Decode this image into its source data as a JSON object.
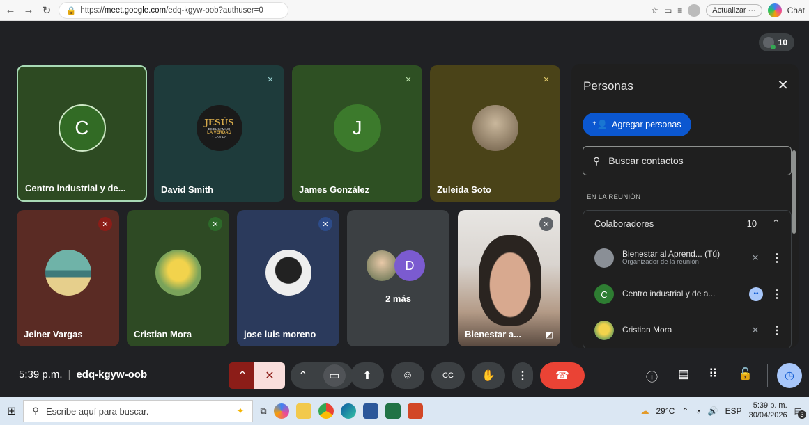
{
  "browser": {
    "url_prefix": "https://",
    "url_host": "meet.google.com",
    "url_path": "/edq-kgyw-oob?authuser=0",
    "update_label": "Actualizar",
    "chat_label": "Chat"
  },
  "meeting": {
    "participant_count": "10",
    "time": "5:39 p.m.",
    "code": "edq-kgyw-oob"
  },
  "tiles": [
    {
      "name": "Centro industrial y de...",
      "letter": "C"
    },
    {
      "name": "David Smith",
      "logo_title": "JESÚS",
      "logo_lines": [
        "ES EL CAMINO",
        "LA VERDAD",
        "Y LA VIDA"
      ]
    },
    {
      "name": "James González",
      "letter": "J"
    },
    {
      "name": "Zuleida Soto"
    },
    {
      "name": "Jeiner Vargas"
    },
    {
      "name": "Cristian Mora"
    },
    {
      "name": "jose luis moreno"
    },
    {
      "name": "2 más",
      "letter": "D"
    },
    {
      "name": "Bienestar a..."
    }
  ],
  "panel": {
    "title": "Personas",
    "add_button": "Agregar personas",
    "search_placeholder": "Buscar contactos",
    "section_label": "EN LA REUNIÓN",
    "group_title": "Colaboradores",
    "group_count": "10",
    "members": [
      {
        "name": "Bienestar al Aprend... (Tú)",
        "sub": "Organizador de la reunión"
      },
      {
        "name": "Centro industrial y de a...",
        "letter": "C"
      },
      {
        "name": "Cristian Mora"
      }
    ]
  },
  "taskbar": {
    "search_placeholder": "Escribe aquí para buscar.",
    "weather": "29°C",
    "lang": "ESP",
    "time": "5:39 p. m.",
    "date": "30/04/2026",
    "notif_count": "3"
  },
  "colors": {
    "accent_blue": "#0b57d0",
    "end_call_red": "#ea4335",
    "mic_off_pink": "#f9dedc",
    "tile_green": "#2d4a22",
    "speaking_border": "#a8dab5"
  }
}
